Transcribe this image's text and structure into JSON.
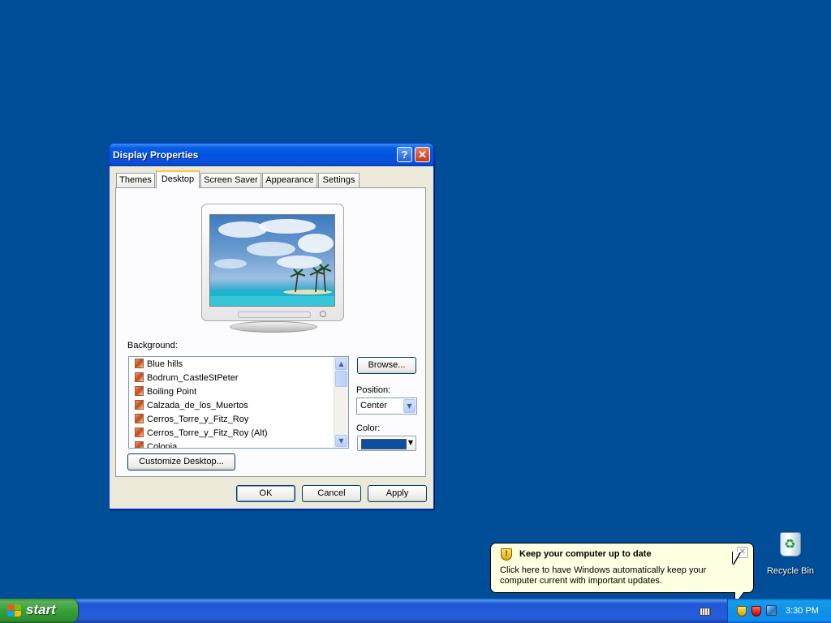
{
  "dialog": {
    "title": "Display Properties",
    "help_glyph": "?",
    "close_glyph": "✕",
    "tabs": [
      {
        "label": "Themes",
        "active": false
      },
      {
        "label": "Desktop",
        "active": true
      },
      {
        "label": "Screen Saver",
        "active": false
      },
      {
        "label": "Appearance",
        "active": false
      },
      {
        "label": "Settings",
        "active": false
      }
    ],
    "background_label": "Background:",
    "background_items": [
      "Blue hills",
      "Bodrum_CastleStPeter",
      "Boiling Point",
      "Calzada_de_los_Muertos",
      "Cerros_Torre_y_Fitz_Roy",
      "Cerros_Torre_y_Fitz_Roy (Alt)",
      "Colonia"
    ],
    "browse_label": "Browse...",
    "position_label": "Position:",
    "position_value": "Center",
    "color_label": "Color:",
    "color_value": "#0b4ea2",
    "customize_label": "Customize Desktop...",
    "ok_label": "OK",
    "cancel_label": "Cancel",
    "apply_label": "Apply"
  },
  "desktop": {
    "background_color": "#004e98",
    "icons": [
      {
        "label": "Recycle Bin",
        "icon": "recycle-bin-icon"
      }
    ]
  },
  "balloon": {
    "icon": "security-shield-icon",
    "title": "Keep your computer up to date",
    "body": "Click here to have Windows automatically keep your computer current with important updates."
  },
  "taskbar": {
    "start_label": "start",
    "clock": "3:30 PM",
    "tray_icons": [
      "keyboard-icon",
      "security-shield-icon",
      "security-alert-icon",
      "network-icon"
    ]
  }
}
